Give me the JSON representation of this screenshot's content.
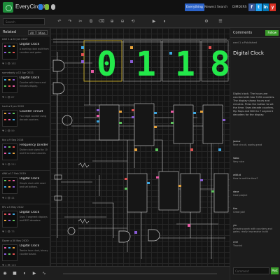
{
  "header": {
    "brand": "EveryCircuit",
    "nav": [
      "Everything",
      "Newest",
      "Search",
      "DIMDERS"
    ],
    "social": [
      "f",
      "t",
      "in",
      "y"
    ]
  },
  "toolbar": {
    "search_placeholder": "Search",
    "tools": [
      "↶",
      "↷",
      "✂",
      "⧉",
      "⌫",
      "⊕",
      "⊖",
      "⟲",
      "▶",
      "⏸",
      "⚙",
      "☰"
    ]
  },
  "left_panel": {
    "title": "Related",
    "filter_buttons": [
      "All",
      "Mine"
    ],
    "cards": [
      {
        "meta": "ezel 1 ◂ 24 Jun 2019",
        "title": "Digital Clock",
        "desc": "A working clock built from counters and gates.",
        "stats": "♥ 3  👁 162"
      },
      {
        "meta": "somebody ◂ 12 Apr 2021",
        "title": "Digital Clock",
        "desc": "Counter with hours and minutes display.",
        "stats": "♥ 1  👁 87"
      },
      {
        "meta": "hadi ◂ 3 Jan 2020",
        "title": "Counter circuit",
        "desc": "Four digit counter using decade counters.",
        "stats": "♥ 2  👁 59"
      },
      {
        "meta": "tbx ◂ 9 Sep 2018",
        "title": "Frequency Divider",
        "desc": "Divide clock signal by 10 and 6 to make seconds.",
        "stats": "♥ 5  👁 211"
      },
      {
        "meta": "ANK ◂ 17 Feb 2019",
        "title": "Digital Clock",
        "desc": "Simple clock with reset and set buttons.",
        "stats": "♥ 0  👁 44"
      },
      {
        "meta": "MV ◂ 5 May 2022",
        "title": "Digital Clock",
        "desc": "Uses 7 segment displays and BCD decoders.",
        "stats": "♥ 1  👁 73"
      },
      {
        "meta": "Dozer ◂ 30 Nov 2020",
        "title": "Digital Clock",
        "desc": "Twelve hour clock, binary counter based.",
        "stats": "♥ 4  👁 120"
      }
    ]
  },
  "circuit": {
    "digits": [
      "0",
      "1",
      "1",
      "8"
    ]
  },
  "right_panel": {
    "title": "Comments",
    "action": "Follow",
    "author": "ezel 1 ◂ Published",
    "circuit_title": "Digital Clock",
    "description": "Digital clock. The hours are counted with two 7490 counters. The display shows hours and minutes. Press the button to set the time. Uses decade counters, flip flops and BCD to 7 segment decoders for the display.",
    "comments": [
      {
        "user": "jauhar",
        "text": "Nice circuit, works great"
      },
      {
        "user": "Sabo",
        "text": "Very nice"
      },
      {
        "user": "wild.st",
        "text": "How to set the time?"
      },
      {
        "user": "dave",
        "text": "Cool project"
      },
      {
        "user": "klm",
        "text": "Great job!"
      },
      {
        "user": "yin",
        "text": "Amazing work with counters and gates, really impressive build"
      },
      {
        "user": "rm9",
        "text": "Thanks!"
      }
    ],
    "comment_placeholder": "Comment",
    "send_label": "Post"
  },
  "colors": {
    "accent": "#2b63c9",
    "green": "#3a9a2a",
    "segment": "#23e84a"
  }
}
